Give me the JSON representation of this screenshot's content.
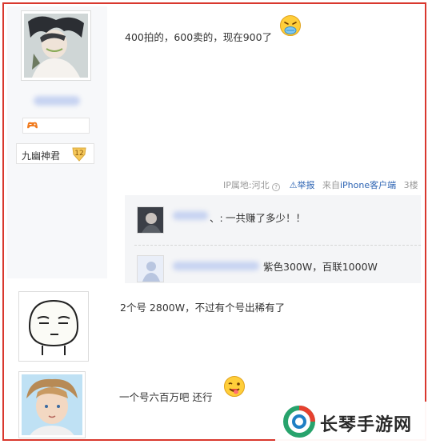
{
  "post1": {
    "text": "400拍的，600卖的，现在900了",
    "badge_name": "九幽神君",
    "badge_level": "12",
    "medal_icon": "gamepad-icon",
    "meta": {
      "ip": "IP属地:河北",
      "report": "举报",
      "from_prefix": "来自",
      "from_link": "iPhone客户端",
      "floor": "3楼"
    }
  },
  "replies": [
    {
      "name_suffix": "、:",
      "text": "一共赚了多少！！"
    },
    {
      "name_visible": "败理用户...",
      "text": "紫色300W，百联1000W"
    }
  ],
  "post2": {
    "text": "2个号 2800W，不过有个号出稀有了"
  },
  "post3": {
    "text": "一个号六百万吧 还行"
  },
  "watermark": {
    "text": "长琴手游网"
  },
  "colors": {
    "frame": "#d9382e",
    "link": "#2d64b3",
    "meta": "#999999"
  }
}
